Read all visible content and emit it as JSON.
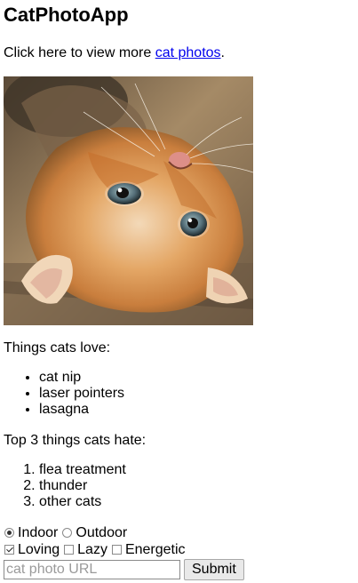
{
  "header": {
    "title": "CatPhotoApp"
  },
  "intro": {
    "prefix": "Click here to view more ",
    "link_text": "cat photos",
    "suffix": "."
  },
  "photo": {
    "alt": "A cute orange cat lying on its back."
  },
  "love": {
    "label": "Things cats love:",
    "items": [
      "cat nip",
      "laser pointers",
      "lasagna"
    ]
  },
  "hate": {
    "label": "Top 3 things cats hate:",
    "items": [
      "flea treatment",
      "thunder",
      "other cats"
    ]
  },
  "form": {
    "radios": [
      {
        "label": "Indoor",
        "checked": true
      },
      {
        "label": "Outdoor",
        "checked": false
      }
    ],
    "checkboxes": [
      {
        "label": "Loving",
        "checked": true
      },
      {
        "label": "Lazy",
        "checked": false
      },
      {
        "label": "Energetic",
        "checked": false
      }
    ],
    "url_placeholder": "cat photo URL",
    "url_value": "",
    "submit_label": "Submit"
  }
}
